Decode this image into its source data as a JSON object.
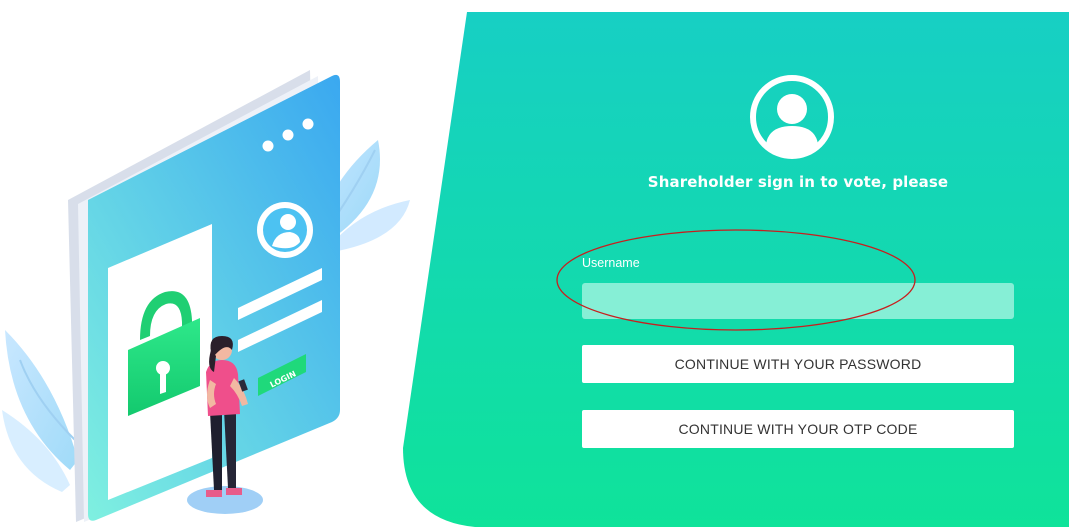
{
  "login": {
    "title": "Shareholder sign in to vote, please",
    "username_label": "Username",
    "username_value": "",
    "username_placeholder": "",
    "password_button_label": "CONTINUE WITH YOUR PASSWORD",
    "otp_button_label": "CONTINUE WITH YOUR OTP CODE"
  },
  "illustration": {
    "login_button_text": "LOGIN"
  },
  "icons": {
    "avatar": "user-circle-icon",
    "padlock": "lock-icon"
  },
  "colors": {
    "panel_top": "#17cfc4",
    "panel_bottom": "#0fe39a",
    "input_bg": "#86efd6",
    "button_bg": "#ffffff",
    "annotation": "#c81e1e"
  }
}
